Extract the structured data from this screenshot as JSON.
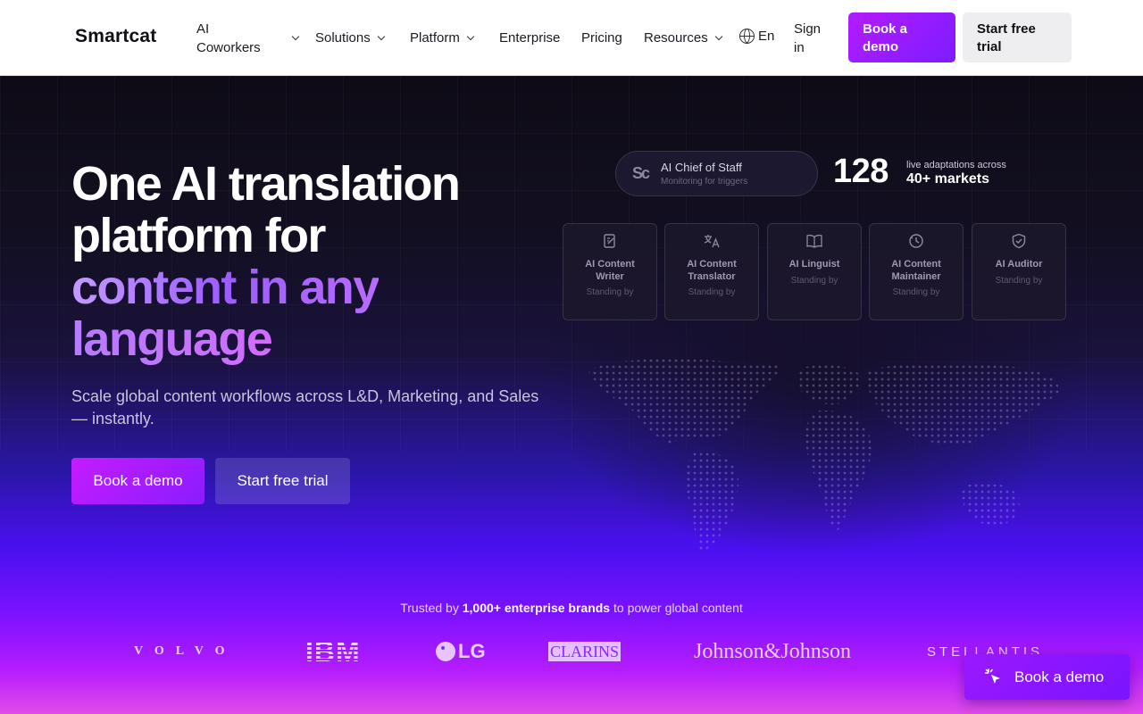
{
  "nav": {
    "logo": "Smartcat",
    "items": [
      {
        "label": "AI Coworkers",
        "line1": "AI",
        "line2": "Coworkers",
        "dropdown": true
      },
      {
        "label": "Solutions",
        "dropdown": true
      },
      {
        "label": "Platform",
        "dropdown": true
      },
      {
        "label": "Enterprise",
        "dropdown": false
      },
      {
        "label": "Pricing",
        "dropdown": false
      },
      {
        "label": "Resources",
        "dropdown": true
      }
    ],
    "language": "En",
    "sign_in_line1": "Sign",
    "sign_in_line2": "in",
    "book_demo_line1": "Book a",
    "book_demo_line2": "demo",
    "start_trial_line1": "Start free",
    "start_trial_line2": "trial"
  },
  "hero": {
    "headline_line1": "One AI translation",
    "headline_line2": "platform for",
    "headline_line3": "content in any",
    "headline_line4": "language",
    "subtitle": "Scale global content workflows across L&D, Marketing, and Sales — instantly.",
    "cta_demo": "Book a demo",
    "cta_trial": "Start free trial"
  },
  "status": {
    "pill_logo": "Sc",
    "pill_title": "AI Chief of Staff",
    "pill_sub": "Monitoring for triggers",
    "count": "128",
    "count_caption": "live adaptations across",
    "count_markets": "40+ markets"
  },
  "agents": [
    {
      "line1": "AI Content",
      "line2": "Writer",
      "status": "Standing by",
      "icon": "edit-icon"
    },
    {
      "line1": "AI Content",
      "line2": "Translator",
      "status": "Standing by",
      "icon": "translate-icon"
    },
    {
      "line1": "AI Linguist",
      "line2": "",
      "status": "Standing by",
      "icon": "book-icon"
    },
    {
      "line1": "AI Content",
      "line2": "Maintainer",
      "status": "Standing by",
      "icon": "refresh-clock-icon"
    },
    {
      "line1": "AI Auditor",
      "line2": "",
      "status": "Standing by",
      "icon": "shield-check-icon"
    }
  ],
  "trusted": {
    "prefix": "Trusted by ",
    "bold": "1,000+ enterprise brands",
    "suffix": " to power global content"
  },
  "brands": [
    "VOLVO",
    "IBM",
    "LG",
    "CLARINS",
    "Johnson&Johnson",
    "STELLANTIS"
  ],
  "float_cta": "Book a demo",
  "colors": {
    "accent": "#9a18ff",
    "accent_hot": "#c41cff",
    "hero_dark": "#0e0b16"
  }
}
